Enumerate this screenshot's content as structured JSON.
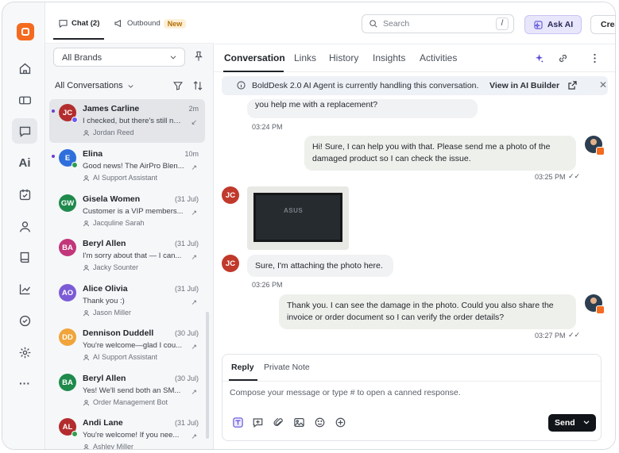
{
  "nav": {
    "logo": "boldesk-logo",
    "items": [
      {
        "name": "home",
        "icon": "home-icon"
      },
      {
        "name": "tickets",
        "icon": "ticket-icon"
      },
      {
        "name": "chat",
        "icon": "chat-icon",
        "active": true
      },
      {
        "name": "ai",
        "icon": "ai-icon",
        "label": "Ai"
      },
      {
        "name": "tasks",
        "icon": "task-icon"
      },
      {
        "name": "contacts",
        "icon": "user-icon"
      },
      {
        "name": "knowledge-base",
        "icon": "book-icon"
      },
      {
        "name": "reports",
        "icon": "chart-icon"
      },
      {
        "name": "approvals",
        "icon": "check-circle-icon"
      },
      {
        "name": "settings",
        "icon": "gear-icon"
      },
      {
        "name": "more",
        "icon": "more-icon",
        "label": "···"
      }
    ]
  },
  "topTabs": {
    "chat": "Chat (2)",
    "outbound": "Outbound",
    "newBadge": "New"
  },
  "brands": {
    "selected": "All Brands"
  },
  "listHeader": {
    "label": "All Conversations"
  },
  "conversations": [
    {
      "initials": "JC",
      "name": "James Carline",
      "time": "2m",
      "message": "I checked, but there's still not...",
      "agent": "Jordan Reed",
      "color": "#b32d2e",
      "selected": true,
      "unread": true,
      "status": "#6a5cf0",
      "arrow": "↙"
    },
    {
      "initials": "E",
      "name": "Elina",
      "time": "10m",
      "message": "Good news! The AirPro Blen...",
      "agent": "AI Support Assistant",
      "color": "#2f6fdb",
      "unread": true,
      "status": "#2e9e4f",
      "arrow": "↗"
    },
    {
      "initials": "GW",
      "name": "Gisela Women",
      "time": "(31 Jul)",
      "message": "Customer is a VIP members...",
      "agent": "Jacquline Sarah",
      "color": "#1e8a4c",
      "arrow": "↗"
    },
    {
      "initials": "BA",
      "name": "Beryl Allen",
      "time": "(31 Jul)",
      "message": "I'm sorry about that — I can...",
      "agent": "Jacky Sounter",
      "color": "#c2367a",
      "arrow": "↗"
    },
    {
      "initials": "AO",
      "name": "Alice Olivia",
      "time": "(31 Jul)",
      "message": "Thank you :)",
      "agent": "Jason Miller",
      "color": "#7b5cd6",
      "arrow": "↗"
    },
    {
      "initials": "DD",
      "name": "Dennison Duddell",
      "time": "(30 Jul)",
      "message": "You're welcome—glad I cou...",
      "agent": "AI Support Assistant",
      "color": "#f0a43a",
      "arrow": "↗"
    },
    {
      "initials": "BA",
      "name": "Beryl Allen",
      "time": "(30 Jul)",
      "message": "Yes! We'll send both an SM...",
      "agent": "Order Management Bot",
      "color": "#1e8a4c",
      "arrow": "↗"
    },
    {
      "initials": "AL",
      "name": "Andi Lane",
      "time": "(31 Jul)",
      "message": "You're welcome! If you nee...",
      "agent": "Ashley Miller",
      "color": "#b32d2e",
      "status": "#2e9e4f",
      "arrow": "↗"
    }
  ],
  "header": {
    "searchPlaceholder": "Search",
    "searchShortcut": "/",
    "askAi": "Ask AI",
    "create": "Create"
  },
  "tabs": {
    "conversation": "Conversation",
    "links": "Links",
    "history": "History",
    "insights": "Insights",
    "activities": "Activities"
  },
  "banner": {
    "text": "BoldDesk 2.0 AI Agent is currently handling this conversation.",
    "link": "View in AI Builder"
  },
  "messages": [
    {
      "side": "in",
      "text": "you help me with a replacement?",
      "time": "03:24 PM"
    },
    {
      "side": "out",
      "text": "Hi! Sure, I can help you with that. Please send me a photo of the damaged product so I can check the issue.",
      "time": "03:25 PM"
    },
    {
      "side": "in",
      "image": "laptop-photo",
      "imageText": "ASUS"
    },
    {
      "side": "in",
      "text": "Sure, I'm attaching the photo here.",
      "time": "03:26 PM",
      "initials": "JC"
    },
    {
      "side": "out",
      "text": "Thank you. I can see the damage in the photo. Could you also share the invoice or order document so I can verify the order details?",
      "time": "03:27 PM"
    }
  ],
  "reply": {
    "tabs": [
      "Reply",
      "Private Note"
    ],
    "placeholder": "Compose your message or type # to open a canned response.",
    "send": "Send"
  }
}
